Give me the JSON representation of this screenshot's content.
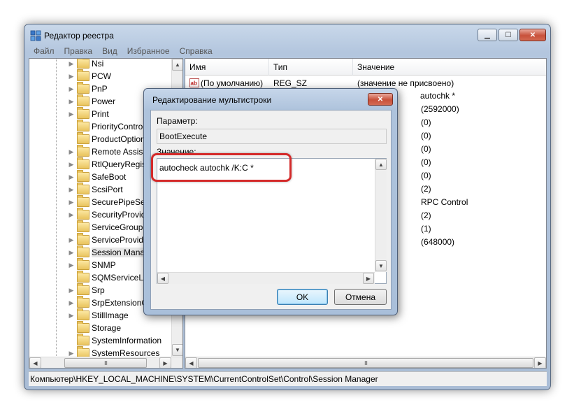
{
  "window": {
    "title": "Редактор реестра",
    "controls": {
      "minimize": "▁",
      "maximize": "☐",
      "close": "✕"
    }
  },
  "menu": [
    "Файл",
    "Правка",
    "Вид",
    "Избранное",
    "Справка"
  ],
  "tree": {
    "items": [
      {
        "label": "Nsi",
        "expandable": true
      },
      {
        "label": "PCW",
        "expandable": true
      },
      {
        "label": "PnP",
        "expandable": true
      },
      {
        "label": "Power",
        "expandable": true
      },
      {
        "label": "Print",
        "expandable": true
      },
      {
        "label": "PriorityContro",
        "expandable": false
      },
      {
        "label": "ProductOption",
        "expandable": false
      },
      {
        "label": "Remote Assist",
        "expandable": true
      },
      {
        "label": "RtlQueryRegist",
        "expandable": true
      },
      {
        "label": "SafeBoot",
        "expandable": true
      },
      {
        "label": "ScsiPort",
        "expandable": true
      },
      {
        "label": "SecurePipeSer",
        "expandable": true
      },
      {
        "label": "SecurityProvid",
        "expandable": true
      },
      {
        "label": "ServiceGroupC",
        "expandable": false
      },
      {
        "label": "ServiceProvide",
        "expandable": true
      },
      {
        "label": "Session Manag",
        "expandable": true,
        "selected": true
      },
      {
        "label": "SNMP",
        "expandable": true
      },
      {
        "label": "SQMServiceLis",
        "expandable": false
      },
      {
        "label": "Srp",
        "expandable": true
      },
      {
        "label": "SrpExtensionC",
        "expandable": true
      },
      {
        "label": "StillImage",
        "expandable": true
      },
      {
        "label": "Storage",
        "expandable": false
      },
      {
        "label": "SystemInformation",
        "expandable": false
      },
      {
        "label": "SystemResources",
        "expandable": true
      }
    ]
  },
  "list": {
    "columns": [
      "Имя",
      "Тип",
      "Значение"
    ],
    "first_row": {
      "name": "(По умолчанию)",
      "type": "REG_SZ",
      "value": "(значение не присвоено)"
    },
    "visible_value_fragments": [
      "autochk *",
      "(2592000)",
      "(0)",
      "(0)",
      "(0)",
      "(0)",
      "(0)",
      "(2)",
      "RPC Control",
      "(2)",
      "(1)",
      "(648000)"
    ]
  },
  "statusbar": {
    "path": "Компьютер\\HKEY_LOCAL_MACHINE\\SYSTEM\\CurrentControlSet\\Control\\Session Manager"
  },
  "dialog": {
    "title": "Редактирование мультистроки",
    "close": "✕",
    "param_label": "Параметр:",
    "param_value": "BootExecute",
    "value_label": "Значение:",
    "value_text": "autocheck autochk /K:C *",
    "ok_label": "OK",
    "cancel_label": "Отмена"
  },
  "scroll": {
    "up": "▲",
    "down": "▼",
    "left": "◀",
    "right": "▶",
    "grip": "III"
  },
  "colors": {
    "highlight": "#d42a2a",
    "titlebar": "#b9cce3"
  }
}
